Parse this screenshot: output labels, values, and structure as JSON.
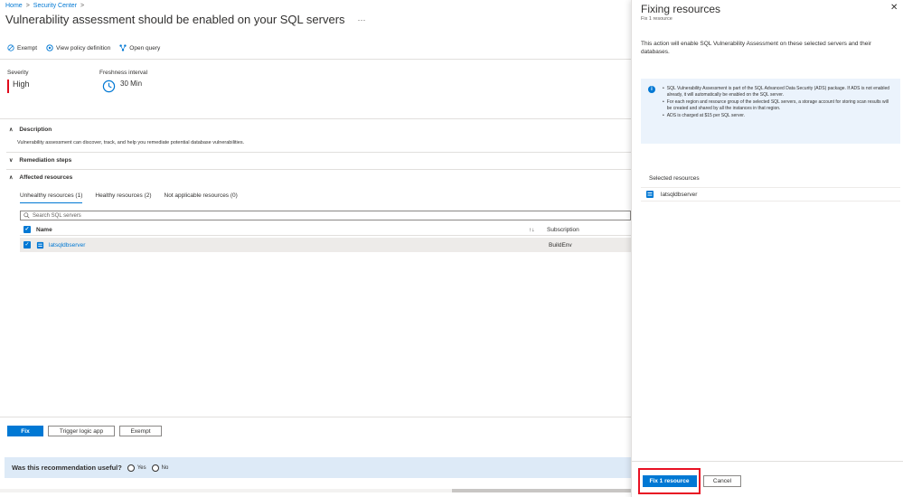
{
  "breadcrumb": {
    "home": "Home",
    "security_center": "Security Center",
    "sep": ">"
  },
  "page": {
    "title": "Vulnerability assessment should be enabled on your SQL servers",
    "more": "···"
  },
  "toolbar": {
    "exempt": "Exempt",
    "view_policy": "View policy definition",
    "open_query": "Open query"
  },
  "severity": {
    "label": "Severity",
    "value": "High"
  },
  "freshness": {
    "label": "Freshness interval",
    "value": "30 Min"
  },
  "sections": {
    "description": {
      "label": "Description",
      "text": "Vulnerability assessment can discover, track, and help you remediate potential database vulnerabilities."
    },
    "remediation": {
      "label": "Remediation steps"
    },
    "affected": {
      "label": "Affected resources"
    }
  },
  "tabs": [
    {
      "label": "Unhealthy resources (1)"
    },
    {
      "label": "Healthy resources (2)"
    },
    {
      "label": "Not applicable resources (0)"
    }
  ],
  "search": {
    "placeholder": "Search SQL servers"
  },
  "table": {
    "headers": {
      "name": "Name",
      "sort": "↑↓",
      "subscription": "Subscription"
    },
    "rows": [
      {
        "name": "latsqldbserver",
        "subscription": "BuildEnv"
      }
    ]
  },
  "actions": {
    "fix": "Fix",
    "trigger": "Trigger logic app",
    "exempt": "Exempt"
  },
  "feedback": {
    "question": "Was this recommendation useful?",
    "yes": "Yes",
    "no": "No"
  },
  "panel": {
    "title": "Fixing resources",
    "subtitle": "Fix 1 resource",
    "close": "✕",
    "text": "This action will enable SQL Vulnerability Assessment on these selected servers and their databases.",
    "info": [
      "SQL Vulnerability Assessment is part of the SQL Advanced Data Security (ADS) package. If ADS is not enabled already, it will automatically be enabled on the SQL server.",
      "For each region and resource group of the selected SQL servers, a storage account for storing scan results will be created and shared by all the instances in that region.",
      "ADS is charged at $15 per SQL server."
    ],
    "selected_label": "Selected resources",
    "selected": [
      {
        "name": "latsqldbserver"
      }
    ],
    "fix_button": "Fix 1 resource",
    "cancel_button": "Cancel"
  },
  "colors": {
    "accent": "#0078d4",
    "severity_high": "#e00b1c",
    "highlight": "#e81123"
  }
}
